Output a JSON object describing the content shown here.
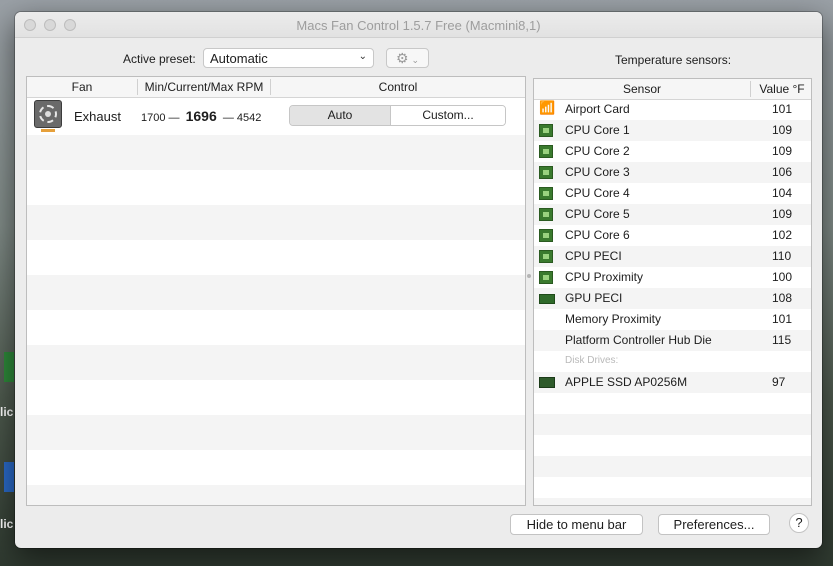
{
  "window": {
    "title": "Macs Fan Control 1.5.7 Free (Macmini8,1)"
  },
  "desktop": {
    "label_1": "lic",
    "label_2": "lic"
  },
  "toolbar": {
    "preset_label": "Active preset:",
    "preset_value": "Automatic",
    "settings_icon": "gear-icon"
  },
  "fans": {
    "headers": {
      "fan": "Fan",
      "rpm": "Min/Current/Max RPM",
      "control": "Control"
    },
    "rows": [
      {
        "name": "Exhaust",
        "min": "1700",
        "current": "1696",
        "max": "4542",
        "sep": "—",
        "mode_auto": "Auto",
        "mode_custom": "Custom..."
      }
    ]
  },
  "sensors": {
    "title": "Temperature sensors:",
    "headers": {
      "sensor": "Sensor",
      "value": "Value °F"
    },
    "rows": [
      {
        "icon": "wifi-icon",
        "name": "Airport Card",
        "value": "101"
      },
      {
        "icon": "cpu-chip-icon",
        "name": "CPU Core 1",
        "value": "109"
      },
      {
        "icon": "cpu-chip-icon",
        "name": "CPU Core 2",
        "value": "109"
      },
      {
        "icon": "cpu-chip-icon",
        "name": "CPU Core 3",
        "value": "106"
      },
      {
        "icon": "cpu-chip-icon",
        "name": "CPU Core 4",
        "value": "104"
      },
      {
        "icon": "cpu-chip-icon",
        "name": "CPU Core 5",
        "value": "109"
      },
      {
        "icon": "cpu-chip-icon",
        "name": "CPU Core 6",
        "value": "102"
      },
      {
        "icon": "cpu-chip-icon",
        "name": "CPU PECI",
        "value": "110"
      },
      {
        "icon": "cpu-chip-icon",
        "name": "CPU Proximity",
        "value": "100"
      },
      {
        "icon": "gpu-card-icon",
        "name": "GPU PECI",
        "value": "108"
      },
      {
        "icon": "",
        "name": "Memory Proximity",
        "value": "101"
      },
      {
        "icon": "",
        "name": "Platform Controller Hub Die",
        "value": "115"
      }
    ],
    "disk_section": "Disk Drives:",
    "disks": [
      {
        "icon": "ssd-icon",
        "name": "APPLE SSD AP0256M",
        "value": "97"
      }
    ]
  },
  "footer": {
    "hide_label": "Hide to menu bar",
    "preferences_label": "Preferences...",
    "help_label": "?"
  }
}
